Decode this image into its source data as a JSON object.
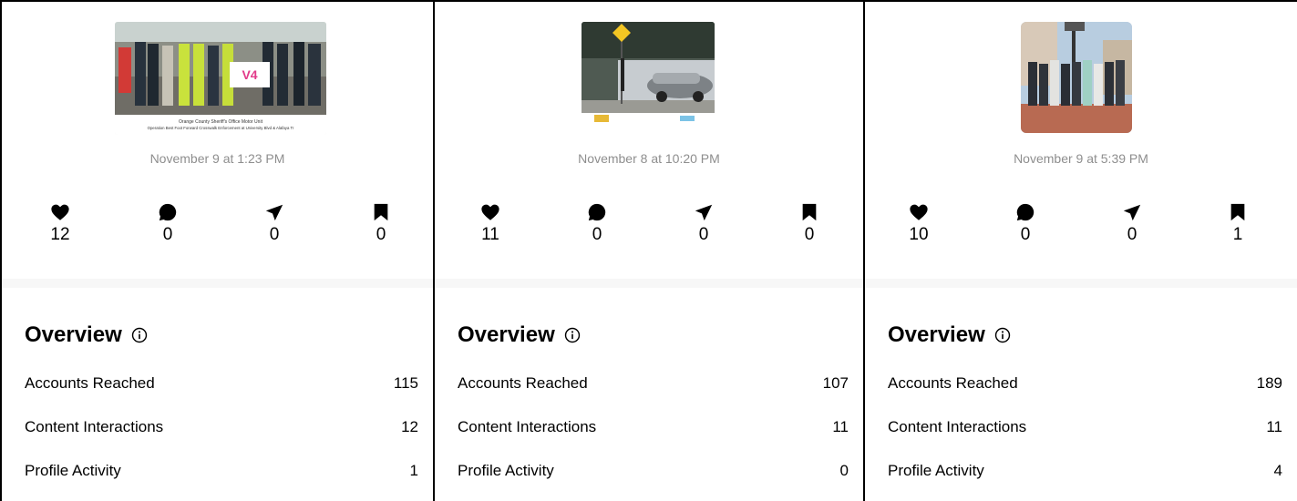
{
  "panels": [
    {
      "date": "November 9 at 1:23 PM",
      "thumb": {
        "caption_line1": "Orange County Sheriff's Office Motor Unit",
        "caption_line2": "Operation Best Foot Forward Crosswalk Enforcement at University Blvd & Alafaya Tr",
        "sign_text": "V4"
      },
      "stats": {
        "likes": "12",
        "comments": "0",
        "shares": "0",
        "saves": "0"
      },
      "overview": {
        "title": "Overview",
        "rows": [
          {
            "label": "Accounts Reached",
            "value": "115"
          },
          {
            "label": "Content Interactions",
            "value": "12"
          },
          {
            "label": "Profile Activity",
            "value": "1"
          }
        ]
      }
    },
    {
      "date": "November 8 at 10:20 PM",
      "stats": {
        "likes": "11",
        "comments": "0",
        "shares": "0",
        "saves": "0"
      },
      "overview": {
        "title": "Overview",
        "rows": [
          {
            "label": "Accounts Reached",
            "value": "107"
          },
          {
            "label": "Content Interactions",
            "value": "11"
          },
          {
            "label": "Profile Activity",
            "value": "0"
          }
        ]
      }
    },
    {
      "date": "November 9 at 5:39 PM",
      "stats": {
        "likes": "10",
        "comments": "0",
        "shares": "0",
        "saves": "1"
      },
      "overview": {
        "title": "Overview",
        "rows": [
          {
            "label": "Accounts Reached",
            "value": "189"
          },
          {
            "label": "Content Interactions",
            "value": "11"
          },
          {
            "label": "Profile Activity",
            "value": "4"
          }
        ]
      }
    }
  ],
  "icons": {
    "likes": "heart-icon",
    "comments": "comment-bubble-icon",
    "shares": "send-paper-plane-icon",
    "saves": "bookmark-icon",
    "info": "info-circle-icon"
  },
  "colors": {
    "muted_text": "#8e8e8e",
    "separator": "#f7f7f7"
  }
}
